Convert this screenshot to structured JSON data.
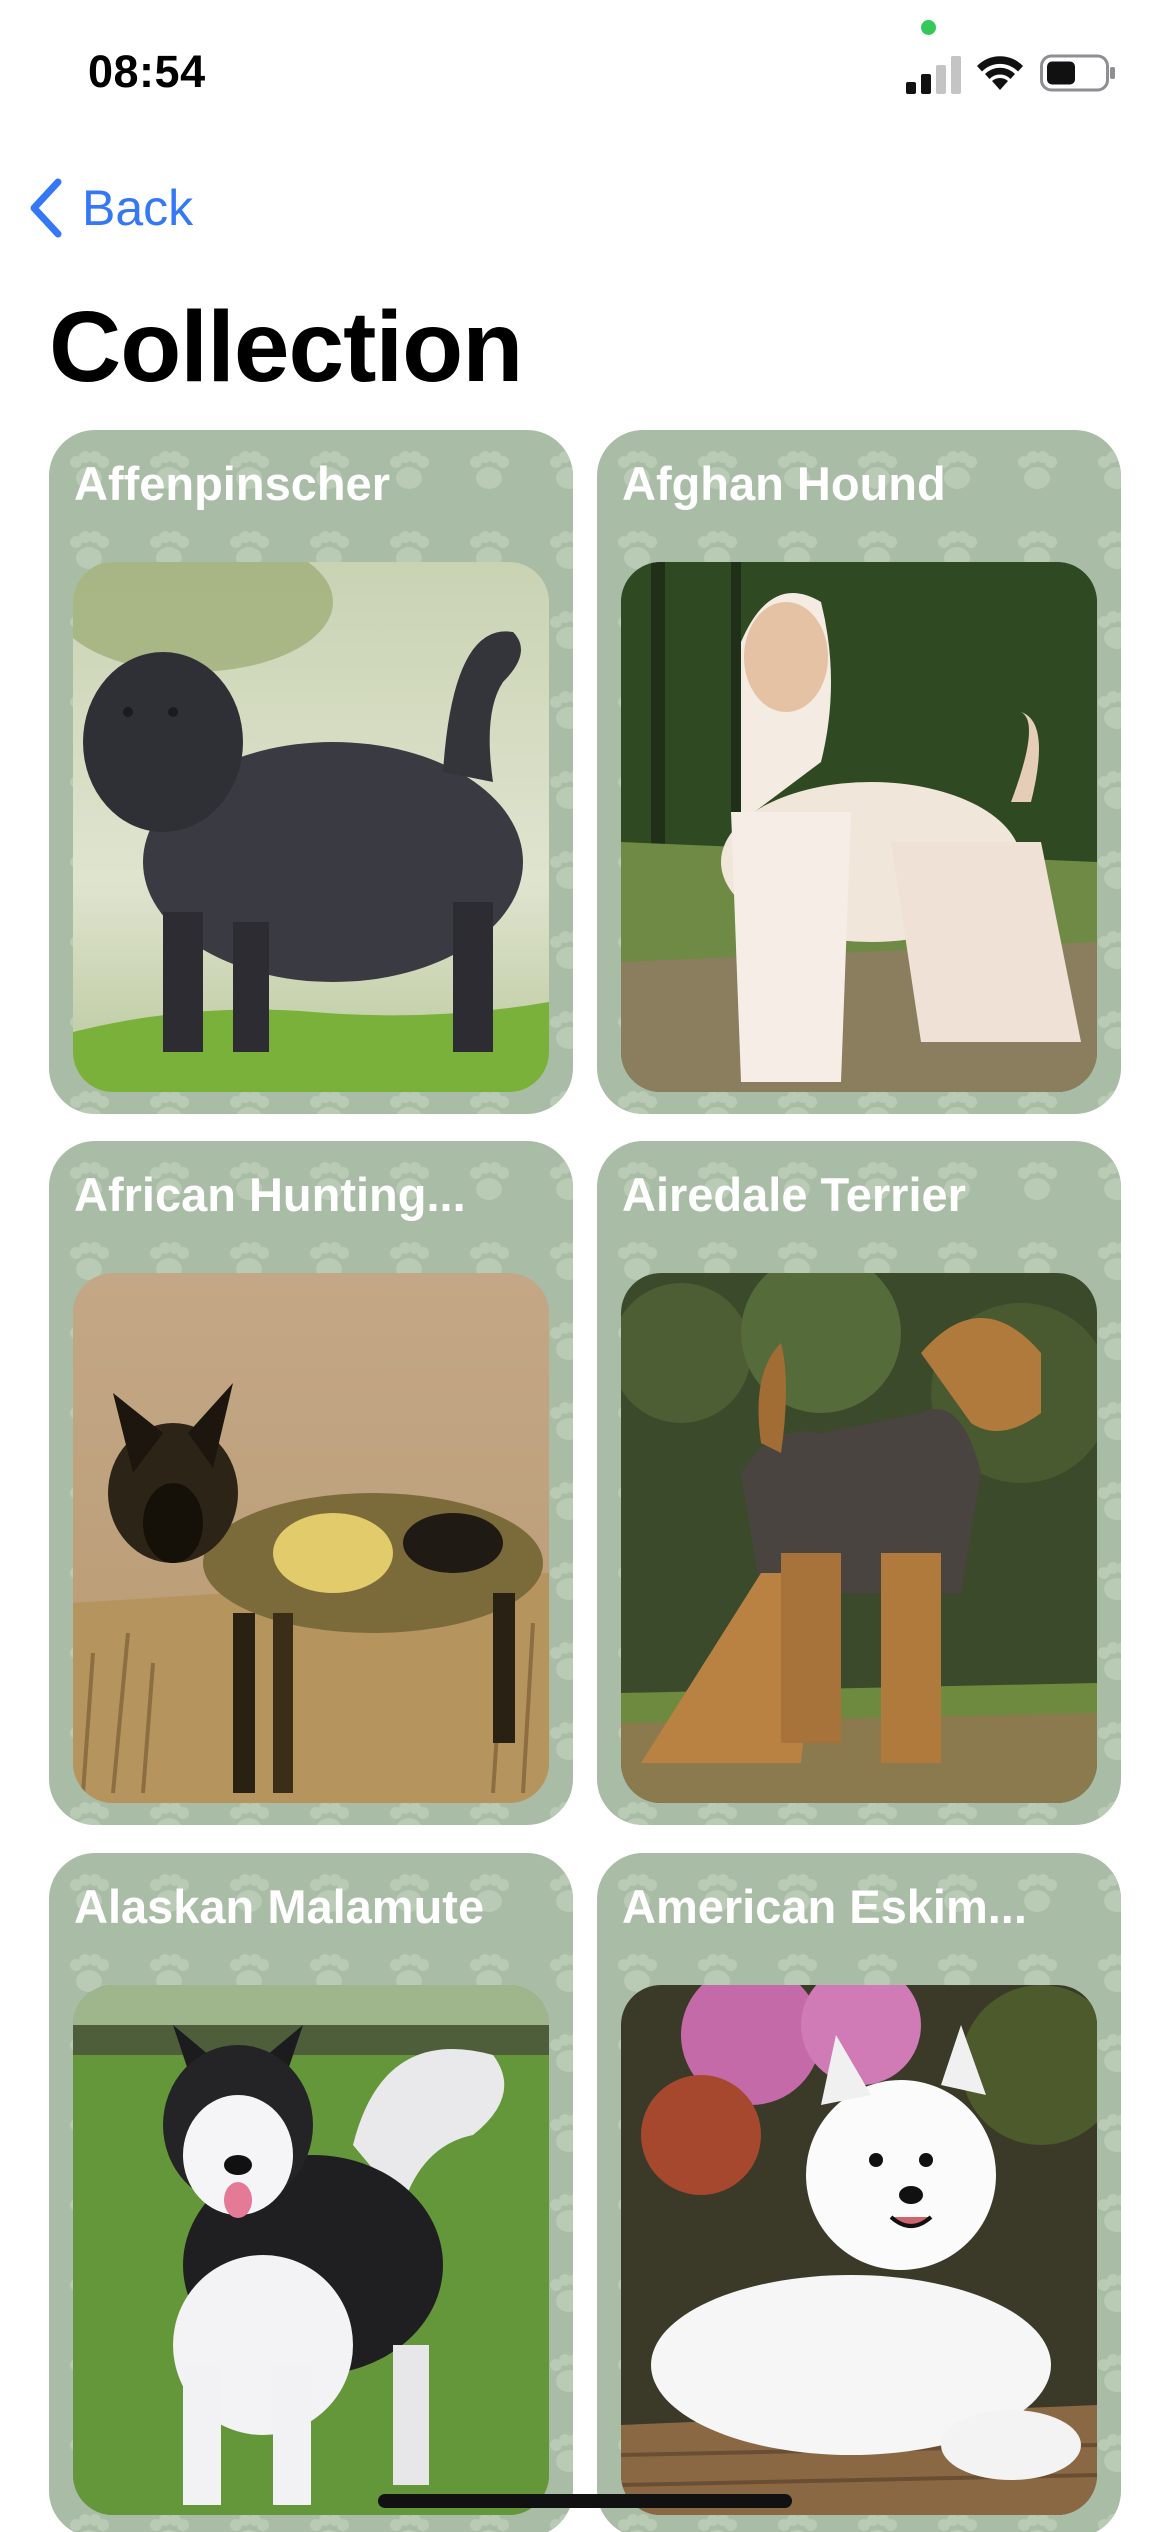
{
  "status_bar": {
    "time": "08:54"
  },
  "nav": {
    "back_label": "Back"
  },
  "page": {
    "title": "Collection"
  },
  "colors": {
    "accent": "#3478f6",
    "card_background": "#a9bca5",
    "paw_pattern": "#b9cab5",
    "card_title": "#ffffff"
  },
  "breeds": [
    {
      "name": "Affenpinscher",
      "photo": "black shaggy dog standing on grass"
    },
    {
      "name": "Afghan Hound",
      "photo": "cream long-haired afghan hound in a field"
    },
    {
      "name": "African Hunting...",
      "photo": "painted wild dog in dry grass"
    },
    {
      "name": "Airedale Terrier",
      "photo": "tan and black airedale terrier standing"
    },
    {
      "name": "Alaskan Malamute",
      "photo": "black and white malamute on a lawn"
    },
    {
      "name": "American Eskim...",
      "photo": "white fluffy eskimo dog lying by flowers"
    }
  ]
}
